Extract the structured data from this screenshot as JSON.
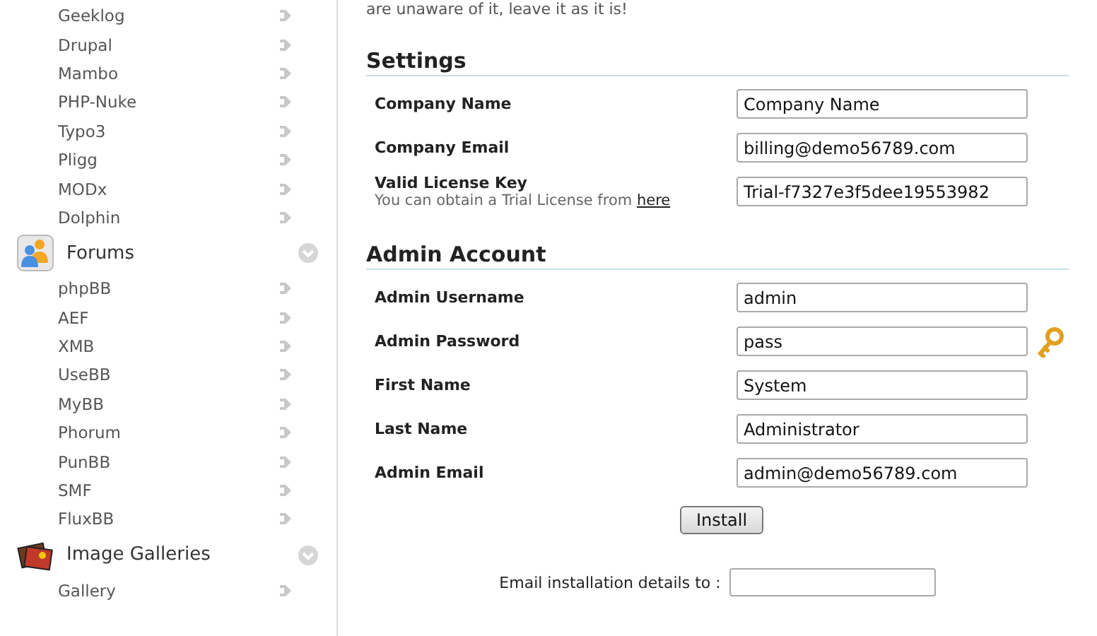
{
  "sidebar": {
    "groups": [
      {
        "items": [
          "Geeklog",
          "Drupal",
          "Mambo",
          "PHP-Nuke",
          "Typo3",
          "Pligg",
          "MODx",
          "Dolphin"
        ]
      },
      {
        "title": "Forums",
        "kind": "forums",
        "items": [
          "phpBB",
          "AEF",
          "XMB",
          "UseBB",
          "MyBB",
          "Phorum",
          "PunBB",
          "SMF",
          "FluxBB"
        ]
      },
      {
        "title": "Image Galleries",
        "kind": "galleries",
        "items": [
          "Gallery"
        ]
      }
    ]
  },
  "intro_text": "are unaware of it, leave it as it is!",
  "sections": [
    {
      "title": "Settings",
      "fields": [
        {
          "kind": "text",
          "label": "Company Name",
          "value": "Company Name"
        },
        {
          "kind": "text",
          "label": "Company Email",
          "value": "billing@demo56789.com"
        },
        {
          "kind": "text",
          "label": "Valid License Key",
          "value": "Trial-f7327e3f5dee19553982",
          "hint": "You can obtain a Trial License from",
          "hint_link": "here"
        }
      ]
    },
    {
      "title": "Admin Account",
      "fields": [
        {
          "kind": "text",
          "label": "Admin Username",
          "value": "admin"
        },
        {
          "kind": "password",
          "label": "Admin Password",
          "value": "pass"
        },
        {
          "kind": "text",
          "label": "First Name",
          "value": "System"
        },
        {
          "kind": "text",
          "label": "Last Name",
          "value": "Administrator"
        },
        {
          "kind": "text",
          "label": "Admin Email",
          "value": "admin@demo56789.com"
        }
      ]
    }
  ],
  "install_button": "Install",
  "email_details": {
    "label": "Email installation details to :"
  }
}
